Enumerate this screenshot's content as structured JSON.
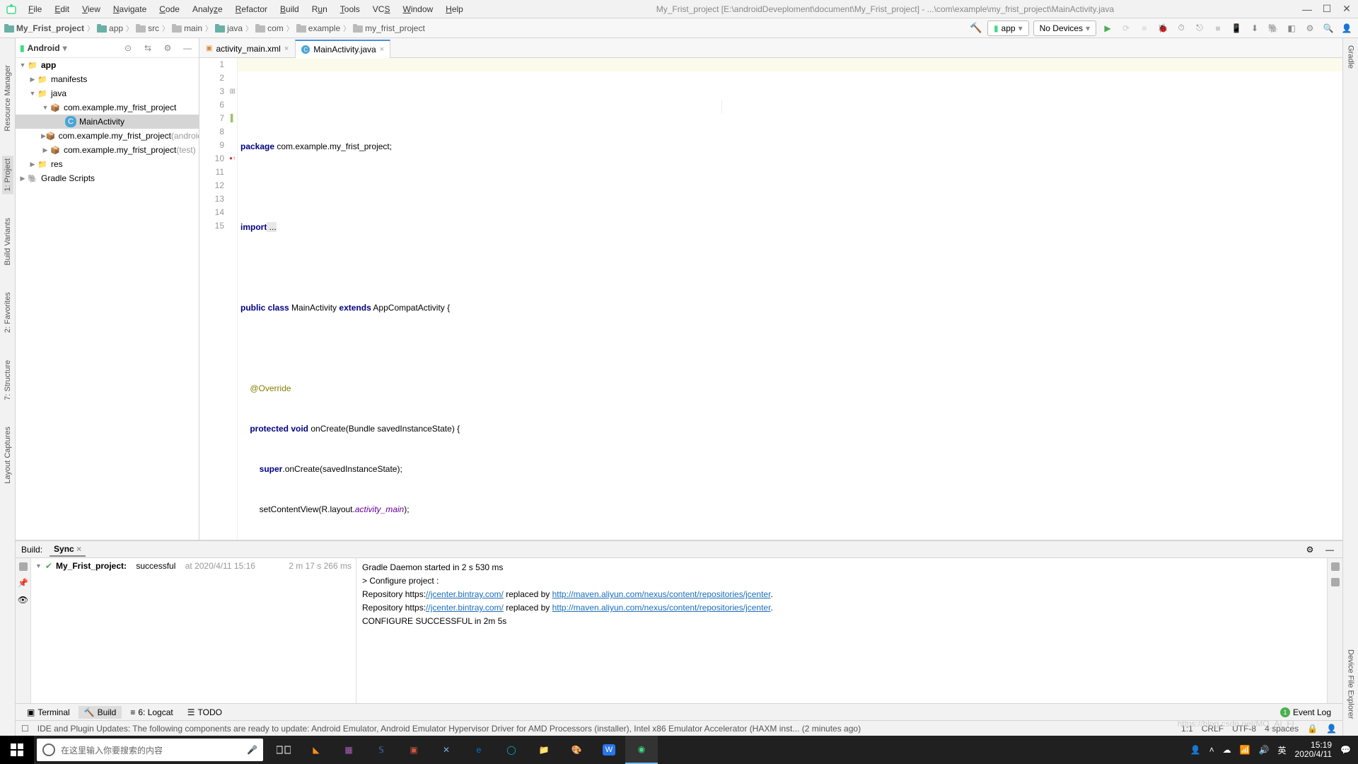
{
  "window": {
    "title": "My_Frist_project [E:\\androidDeveploment\\document\\My_Frist_project] - ...\\com\\example\\my_frist_project\\MainActivity.java"
  },
  "menu": [
    "File",
    "Edit",
    "View",
    "Navigate",
    "Code",
    "Analyze",
    "Refactor",
    "Build",
    "Run",
    "Tools",
    "VCS",
    "Window",
    "Help"
  ],
  "breadcrumb": [
    "My_Frist_project",
    "app",
    "src",
    "main",
    "java",
    "com",
    "example",
    "my_frist_project"
  ],
  "run_config": {
    "app": "app",
    "device": "No Devices"
  },
  "project_pane": {
    "title": "Android",
    "tree": {
      "app": "app",
      "manifests": "manifests",
      "java": "java",
      "pkg1": "com.example.my_frist_project",
      "main_activity": "MainActivity",
      "pkg2": "com.example.my_frist_project",
      "pkg2_suffix": "(androidTest)",
      "pkg3": "com.example.my_frist_project",
      "pkg3_suffix": "(test)",
      "res": "res",
      "gradle": "Gradle Scripts"
    }
  },
  "tabs": [
    {
      "name": "activity_main.xml",
      "active": false
    },
    {
      "name": "MainActivity.java",
      "active": true
    }
  ],
  "code_lines": [
    1,
    2,
    3,
    6,
    7,
    8,
    9,
    10,
    11,
    12,
    13,
    14,
    15
  ],
  "code": {
    "l1_kw": "package",
    "l1_rest": " com.example.my_frist_project;",
    "l3_kw": "import",
    "l3_rest": " ...",
    "l7": "public class",
    "l7_name": " MainActivity ",
    "l7_ext": "extends",
    "l7_rest": " AppCompatActivity {",
    "l9": "@Override",
    "l10_a": "    protected void",
    "l10_b": " onCreate(Bundle savedInstanceState) {",
    "l11_a": "        super",
    "l11_b": ".onCreate(savedInstanceState);",
    "l12_a": "        setContentView(R.layout.",
    "l12_b": "activity_main",
    "l12_c": ");",
    "l13": "    }",
    "l14": "}"
  },
  "build": {
    "label": "Build:",
    "sync_tab": "Sync",
    "project": "My_Frist_project:",
    "status": "successful",
    "time": "at 2020/4/11 15:16",
    "duration": "2 m 17 s 266 ms",
    "out_l1": "Gradle Daemon started in 2 s 530 ms",
    "out_l2": "> Configure project :",
    "out_l3a": "Repository https:",
    "out_link1": "//jcenter.bintray.com/",
    "out_l3b": " replaced by ",
    "out_link2": "http://maven.aliyun.com/nexus/content/repositories/jcenter",
    "out_l3c": ".",
    "out_l5": "CONFIGURE SUCCESSFUL in 2m 5s"
  },
  "bottom_tabs": {
    "terminal": "Terminal",
    "build": "Build",
    "logcat": "6: Logcat",
    "todo": "TODO",
    "event_log": "Event Log"
  },
  "status": {
    "msg": "IDE and Plugin Updates: The following components are ready to update: Android Emulator, Android Emulator Hypervisor Driver for AMD Processors (installer), Intel x86 Emulator Accelerator (HAXM inst... (2 minutes ago)",
    "pos": "1:1",
    "crlf": "CRLF",
    "enc": "UTF-8",
    "indent": "4 spaces"
  },
  "left_rails": [
    "Resource Manager",
    "1: Project",
    "Build Variants",
    "2: Favorites",
    "7: Structure",
    "Layout Captures"
  ],
  "right_rails": [
    "Gradle",
    "Device File Explorer"
  ],
  "taskbar": {
    "search_placeholder": "在这里输入你要搜索的内容",
    "time": "15:19",
    "date": "2020/4/11"
  },
  "watermark": "https://blog.csdn.net/MO_AI_FI"
}
